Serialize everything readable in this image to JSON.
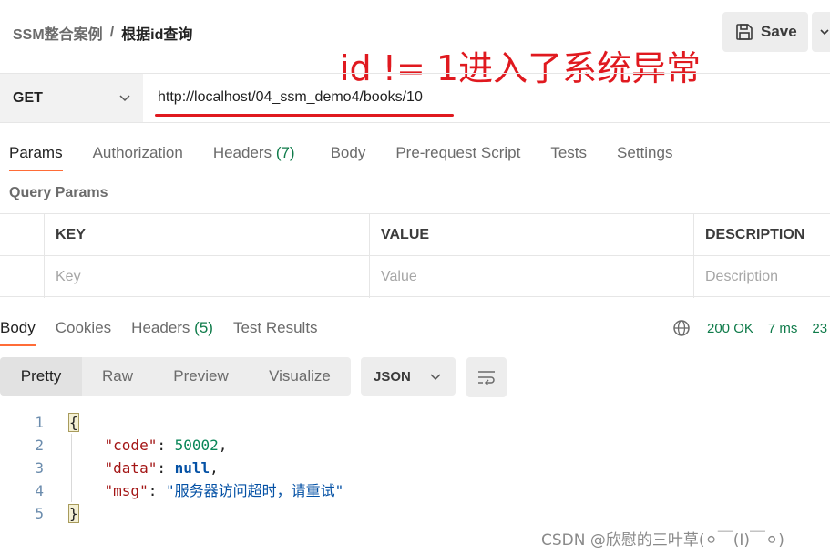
{
  "breadcrumb": {
    "parent": "SSM整合案例",
    "separator": "/",
    "current": "根据id查询"
  },
  "toolbar": {
    "save_label": "Save"
  },
  "annotation": {
    "text": "id != 1进入了系统异常",
    "color": "#e0191f"
  },
  "request": {
    "method": "GET",
    "url": "http://localhost/04_ssm_demo4/books/10"
  },
  "request_tabs": [
    {
      "label": "Params",
      "count": "",
      "active": true
    },
    {
      "label": "Authorization",
      "count": "",
      "active": false
    },
    {
      "label": "Headers",
      "count": "(7)",
      "active": false
    },
    {
      "label": "Body",
      "count": "",
      "active": false
    },
    {
      "label": "Pre-request Script",
      "count": "",
      "active": false
    },
    {
      "label": "Tests",
      "count": "",
      "active": false
    },
    {
      "label": "Settings",
      "count": "",
      "active": false
    }
  ],
  "query_params": {
    "title": "Query Params",
    "columns": [
      "KEY",
      "VALUE",
      "DESCRIPTION"
    ],
    "placeholders": [
      "Key",
      "Value",
      "Description"
    ]
  },
  "response_tabs": [
    {
      "label": "Body",
      "count": "",
      "active": true
    },
    {
      "label": "Cookies",
      "count": "",
      "active": false
    },
    {
      "label": "Headers",
      "count": "(5)",
      "active": false
    },
    {
      "label": "Test Results",
      "count": "",
      "active": false
    }
  ],
  "response_meta": {
    "status": "200 OK",
    "time": "7 ms",
    "size": "23"
  },
  "format_tabs": [
    {
      "label": "Pretty",
      "active": true
    },
    {
      "label": "Raw",
      "active": false
    },
    {
      "label": "Preview",
      "active": false
    },
    {
      "label": "Visualize",
      "active": false
    }
  ],
  "format_select": "JSON",
  "code_lines": [
    {
      "n": "1",
      "open": "{"
    },
    {
      "n": "2",
      "key": "\"code\"",
      "value": "50002",
      "type": "num"
    },
    {
      "n": "3",
      "key": "\"data\"",
      "value": "null",
      "type": "nul"
    },
    {
      "n": "4",
      "key": "\"msg\"",
      "value": "\"服务器访问超时，请重试\"",
      "type": "str",
      "last": true
    },
    {
      "n": "5",
      "close": "}"
    }
  ],
  "watermark": "CSDN @欣慰的三叶草(⚪￣(I)￣⚪)",
  "colors": {
    "accent": "#ff6c37",
    "status_green": "#0f7b4a",
    "annotation_red": "#e0191f"
  }
}
